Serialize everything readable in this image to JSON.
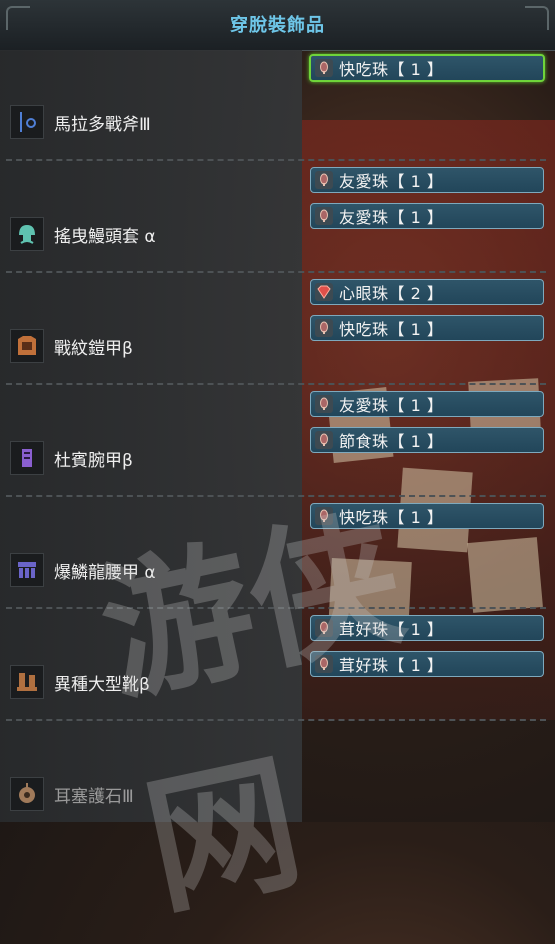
{
  "header": {
    "title": "穿脫裝飾品"
  },
  "slots": [
    {
      "equipment": "馬拉多戰斧Ⅲ",
      "icon": "greatsword-icon",
      "icon_color": "#4f7fd6",
      "decorations": [
        {
          "label": "快吃珠【 1 】",
          "icon": "level1-jewel-icon",
          "selected": true
        }
      ]
    },
    {
      "equipment": "搖曳鰻頭套 α",
      "icon": "helmet-icon",
      "icon_color": "#5fc2b0",
      "decorations": [
        {
          "label": "友愛珠【 1 】",
          "icon": "level1-jewel-icon"
        },
        {
          "label": "友愛珠【 1 】",
          "icon": "level1-jewel-icon"
        }
      ]
    },
    {
      "equipment": "戰紋鎧甲β",
      "icon": "chest-armor-icon",
      "icon_color": "#c0703a",
      "decorations": [
        {
          "label": "心眼珠【 2 】",
          "icon": "level2-jewel-icon"
        },
        {
          "label": "快吃珠【 1 】",
          "icon": "level1-jewel-icon"
        }
      ]
    },
    {
      "equipment": "杜賓腕甲β",
      "icon": "gauntlet-icon",
      "icon_color": "#8a5fd0",
      "decorations": [
        {
          "label": "友愛珠【 1 】",
          "icon": "level1-jewel-icon"
        },
        {
          "label": "節食珠【 1 】",
          "icon": "level1-jewel-icon"
        }
      ]
    },
    {
      "equipment": "爆鱗龍腰甲 α",
      "icon": "waist-armor-icon",
      "icon_color": "#6a64c8",
      "decorations": [
        {
          "label": "快吃珠【 1 】",
          "icon": "level1-jewel-icon"
        }
      ]
    },
    {
      "equipment": "異種大型靴β",
      "icon": "boots-icon",
      "icon_color": "#b07040",
      "decorations": [
        {
          "label": "茸好珠【 1 】",
          "icon": "level1-jewel-icon"
        },
        {
          "label": "茸好珠【 1 】",
          "icon": "level1-jewel-icon"
        }
      ]
    },
    {
      "equipment": "耳塞護石Ⅲ",
      "icon": "charm-icon",
      "icon_color": "#a07a5a",
      "dimmed": true,
      "decorations": []
    }
  ],
  "watermark": "游侠网"
}
